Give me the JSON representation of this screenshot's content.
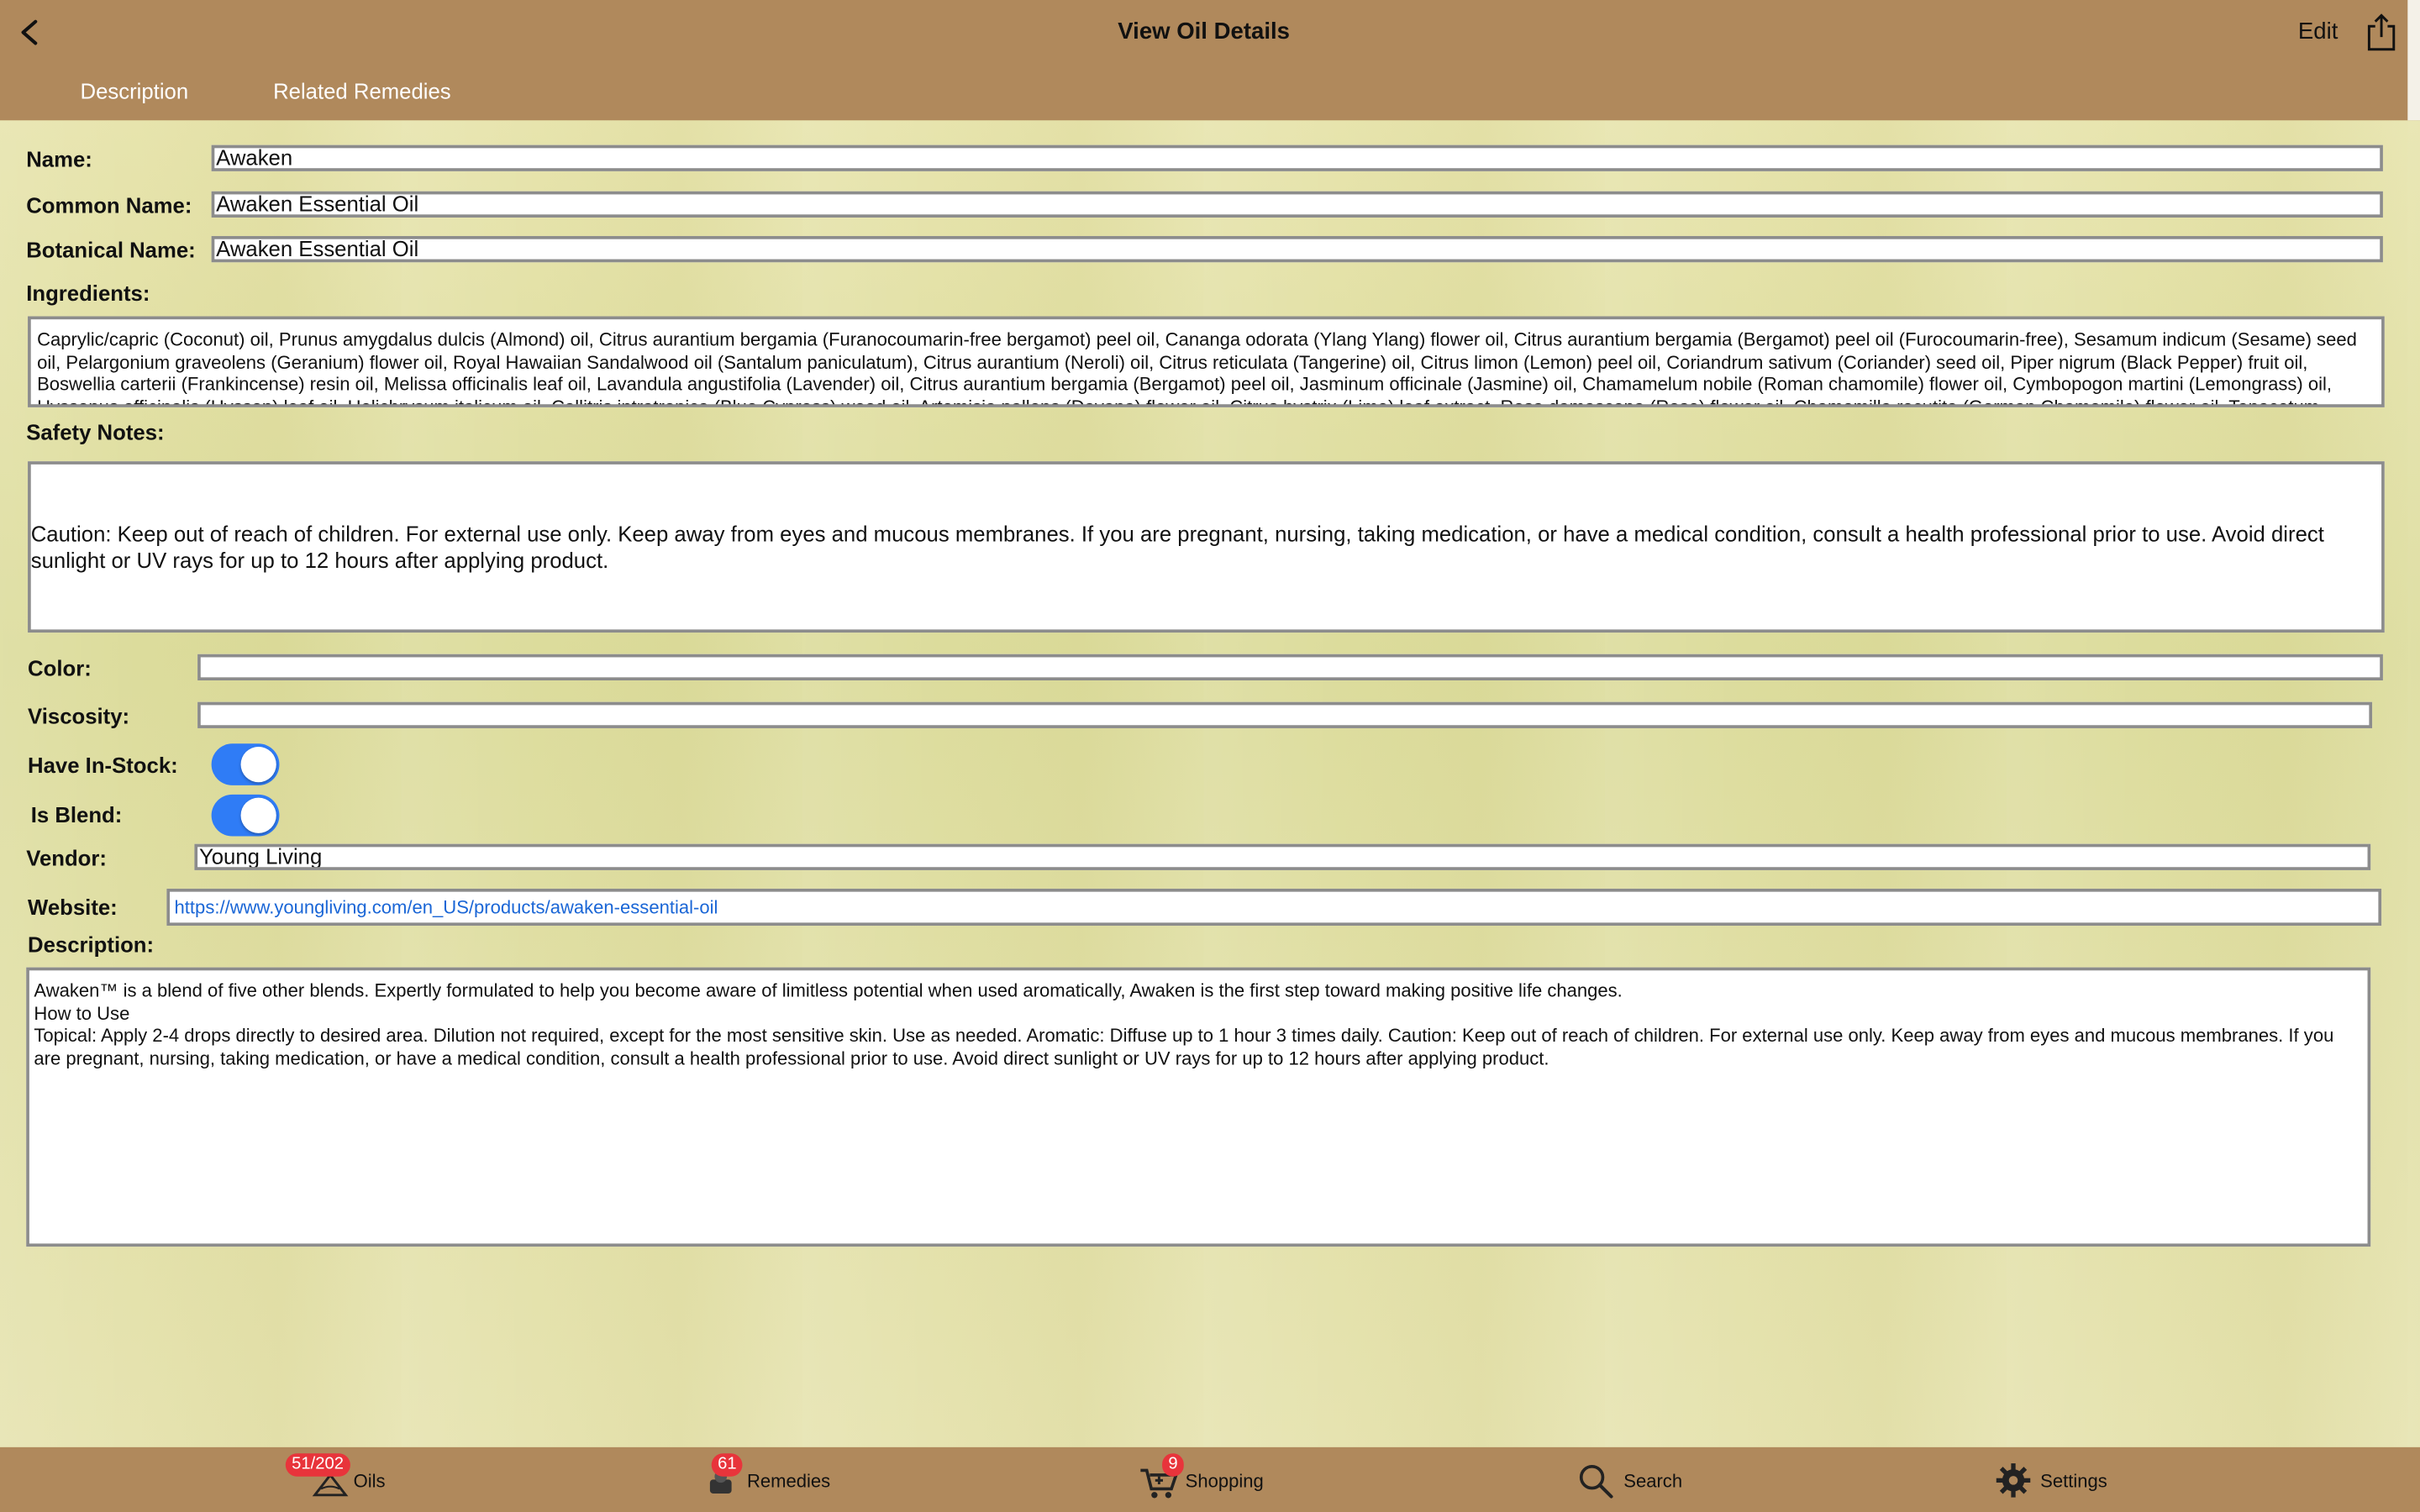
{
  "header": {
    "title": "View Oil Details",
    "edit_label": "Edit",
    "tabs": [
      "Description",
      "Related Remedies"
    ]
  },
  "form": {
    "name_label": "Name:",
    "name_value": "Awaken",
    "common_name_label": "Common Name:",
    "common_name_value": "Awaken Essential Oil",
    "botanical_name_label": "Botanical Name:",
    "botanical_name_value": "Awaken Essential Oil",
    "ingredients_label": "Ingredients:",
    "ingredients_value": "Caprylic/capric (Coconut) oil, Prunus amygdalus dulcis (Almond) oil, Citrus aurantium bergamia (Furanocoumarin-free bergamot) peel oil, Cananga odorata (Ylang Ylang) flower oil, Citrus aurantium bergamia (Bergamot) peel oil (Furocoumarin-free), Sesamum indicum (Sesame) seed oil, Pelargonium graveolens (Geranium) flower oil, Royal Hawaiian Sandalwood oil (Santalum paniculatum), Citrus aurantium (Neroli) oil, Citrus reticulata (Tangerine) oil, Citrus limon (Lemon) peel oil, Coriandrum sativum (Coriander) seed oil, Piper nigrum (Black Pepper) fruit oil, Boswellia carterii (Frankincense) resin oil, Melissa officinalis leaf oil, Lavandula angustifolia (Lavender) oil, Citrus aurantium bergamia (Bergamot) peel oil, Jasminum officinale (Jasmine) oil, Chamamelum nobile (Roman chamomile) flower oil, Cymbopogon martini (Lemongrass) oil, Hyssopus officinalis (Hyssop) leaf oil, Helichrysum italicum oil, Callitris intratropica (Blue Cypress) wood oil, Artemisia pallens (Davana) flower oil, Citrus hystrix (Lime) leaf extract, Rosa damascena (Rose) flower oil, Chamomilla recutita (German Chamomile) flower oil, Tanacetum",
    "safety_label": "Safety Notes:",
    "safety_value": "Caution: Keep out of reach of children. For external use only. Keep away from eyes and mucous membranes. If you are pregnant, nursing, taking medication, or have a medical condition, consult a health professional prior to use. Avoid direct sunlight or UV rays for up to 12 hours after applying product.",
    "color_label": "Color:",
    "color_value": "",
    "viscosity_label": "Viscosity:",
    "viscosity_value": "",
    "in_stock_label": "Have In-Stock:",
    "in_stock_on": true,
    "is_blend_label": "Is Blend:",
    "is_blend_on": true,
    "vendor_label": "Vendor:",
    "vendor_value": "Young Living",
    "website_label": "Website:",
    "website_value": "https://www.youngliving.com/en_US/products/awaken-essential-oil",
    "description_label": "Description:",
    "description_lines": [
      "Awaken™ is a blend of five other blends. Expertly formulated to help you become aware of limitless potential when used aromatically, Awaken is the first step toward making positive life changes.",
      "How to Use",
      "Topical: Apply 2-4 drops directly to desired area. Dilution not required, except for the most sensitive skin. Use as needed. Aromatic: Diffuse up to 1 hour 3 times daily. Caution: Keep out of reach of children. For external use only. Keep away from eyes and mucous membranes. If you are pregnant, nursing, taking medication, or have a medical condition, consult a health professional prior to use. Avoid direct sunlight or UV rays for up to 12 hours after applying product."
    ]
  },
  "tabbar": {
    "oils_label": "Oils",
    "oils_badge": "51/202",
    "remedies_label": "Remedies",
    "remedies_badge": "61",
    "shopping_label": "Shopping",
    "shopping_badge": "9",
    "search_label": "Search",
    "settings_label": "Settings"
  },
  "colors": {
    "bar": "#b0895c",
    "toggle_on": "#2f7cf6",
    "badge": "#e8343b",
    "link": "#1a66d6"
  }
}
